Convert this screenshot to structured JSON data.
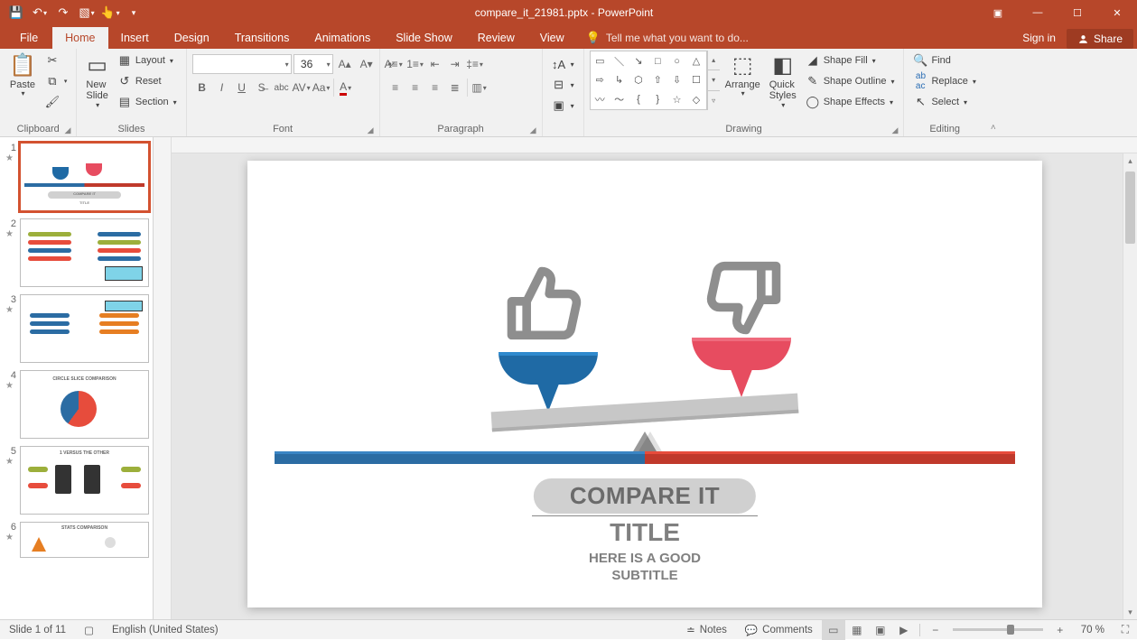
{
  "app": {
    "title_doc": "compare_it_21981.pptx",
    "title_app": "PowerPoint"
  },
  "tabs": {
    "file": "File",
    "home": "Home",
    "insert": "Insert",
    "design": "Design",
    "transitions": "Transitions",
    "animations": "Animations",
    "slideshow": "Slide Show",
    "review": "Review",
    "view": "View",
    "tellme": "Tell me what you want to do...",
    "signin": "Sign in",
    "share": "Share"
  },
  "ribbon": {
    "clipboard": {
      "label": "Clipboard",
      "paste": "Paste"
    },
    "slides": {
      "label": "Slides",
      "new_slide": "New\nSlide",
      "layout": "Layout",
      "reset": "Reset",
      "section": "Section"
    },
    "font": {
      "label": "Font",
      "size": "36"
    },
    "paragraph": {
      "label": "Paragraph"
    },
    "drawing": {
      "label": "Drawing",
      "arrange": "Arrange",
      "quick_styles": "Quick\nStyles",
      "fill": "Shape Fill",
      "outline": "Shape Outline",
      "effects": "Shape Effects"
    },
    "editing": {
      "label": "Editing",
      "find": "Find",
      "replace": "Replace",
      "select": "Select"
    }
  },
  "thumbs": {
    "count": 6,
    "labels": {
      "t2_title": "CIRCLE SLICE COMPARISON",
      "t5_title": "1 VERSUS THE OTHER",
      "t6_title": "STATS COMPARISON"
    }
  },
  "slide": {
    "badge": "COMPARE IT",
    "title": "TITLE",
    "subtitle_l1": "HERE IS A GOOD",
    "subtitle_l2": "SUBTITLE"
  },
  "status": {
    "slide_of": "Slide 1 of 11",
    "lang": "English (United States)",
    "notes": "Notes",
    "comments": "Comments",
    "zoom": "70 %"
  }
}
